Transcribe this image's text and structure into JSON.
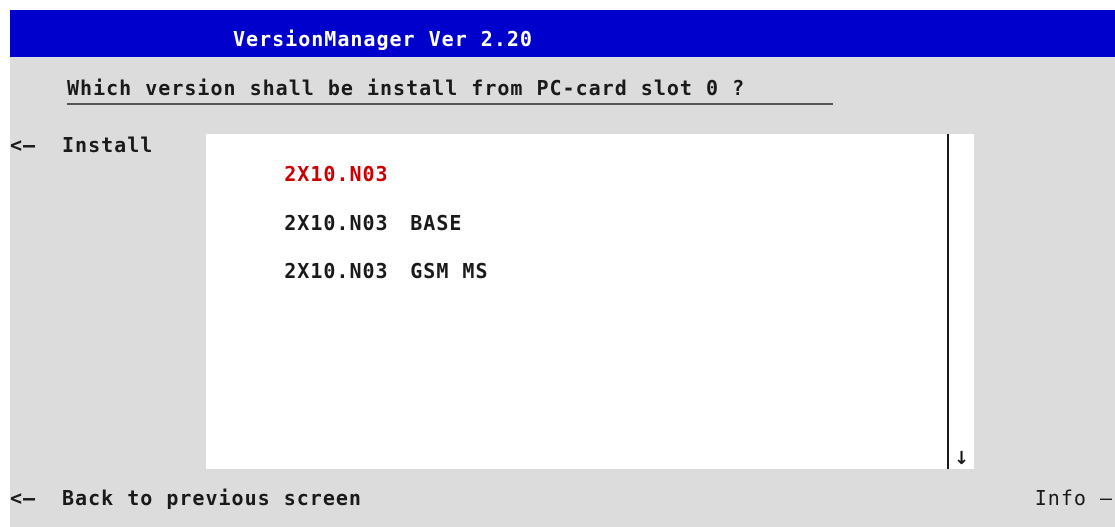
{
  "window": {
    "title": "VersionManager Ver 2.20"
  },
  "prompt": {
    "question": "Which version shall be install from PC-card slot 0 ?"
  },
  "softkeys": {
    "install": {
      "arrow": "<—",
      "label": "Install"
    },
    "back": {
      "arrow": "<—",
      "label": "Back to previous screen"
    },
    "info": {
      "label": "Info",
      "arrow": "—"
    }
  },
  "version_list": {
    "items": [
      {
        "name": "2X10.N03",
        "variant": "",
        "selected": true
      },
      {
        "name": "2X10.N03",
        "variant": "BASE",
        "selected": false
      },
      {
        "name": "2X10.N03",
        "variant": "GSM MS",
        "selected": false
      }
    ],
    "scroll_indicator": "↓"
  },
  "colors": {
    "title_bar": "#0000cc",
    "background": "#dcdcdc",
    "list_background": "#ffffff",
    "selected_text": "#cc0000"
  }
}
